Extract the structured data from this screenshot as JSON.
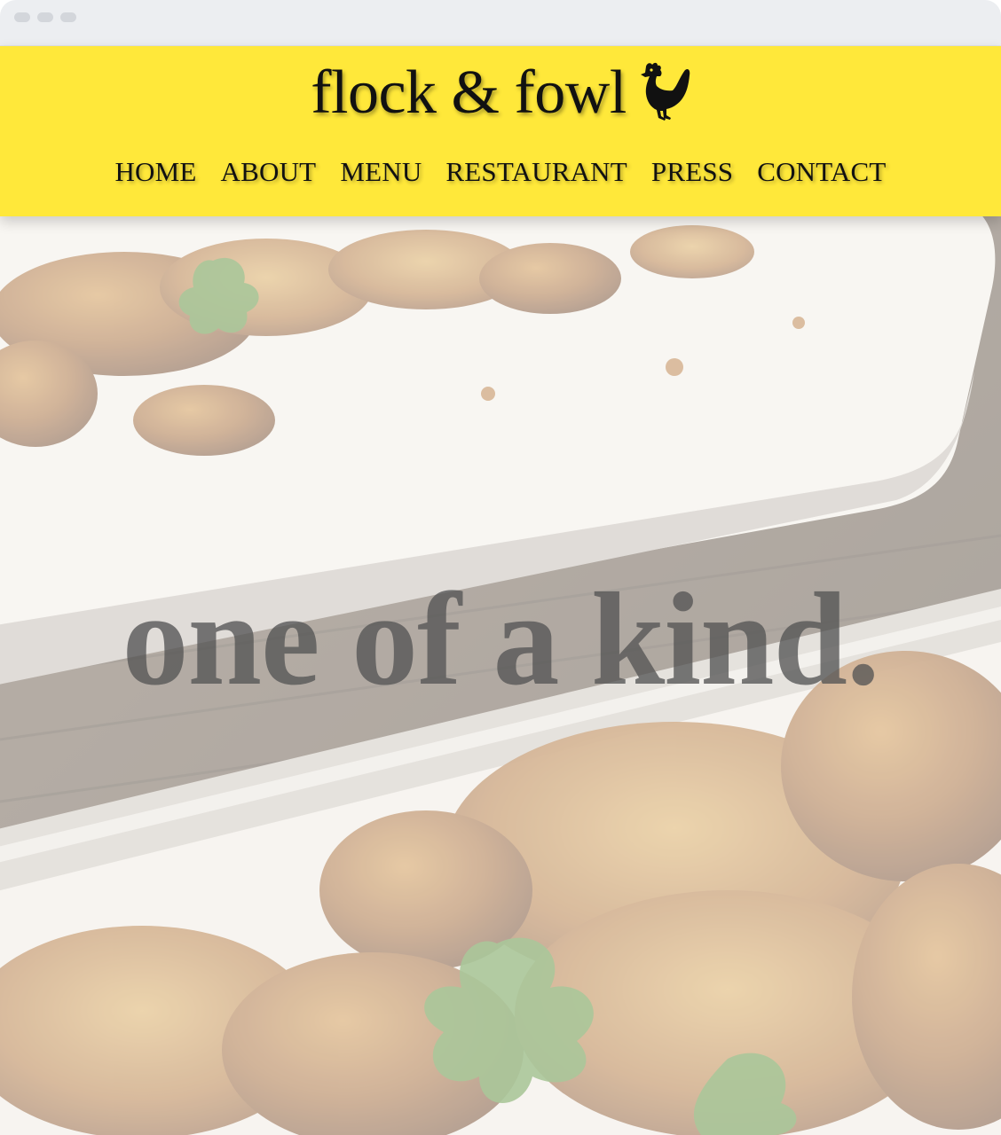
{
  "site": {
    "brand_name": "flock & fowl",
    "brand_icon": "hen-icon"
  },
  "nav": {
    "items": [
      {
        "label": "HOME"
      },
      {
        "label": "ABOUT"
      },
      {
        "label": "MENU"
      },
      {
        "label": "RESTAURANT"
      },
      {
        "label": "PRESS"
      },
      {
        "label": "CONTACT"
      }
    ]
  },
  "hero": {
    "tagline": "one of a kind."
  },
  "colors": {
    "header_background": "#ffe83a",
    "text": "#111111",
    "tagline": "#555555"
  }
}
